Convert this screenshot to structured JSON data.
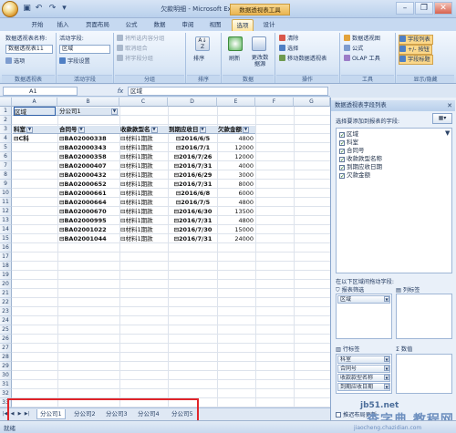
{
  "window": {
    "title": "欠款明细 - Microsoft Excel",
    "context_tab_group": "数据透视表工具"
  },
  "tabs": [
    "开始",
    "插入",
    "页面布局",
    "公式",
    "数据",
    "审阅",
    "视图",
    "选项",
    "设计"
  ],
  "active_tab": "选项",
  "ribbon": {
    "pivot_name_label": "数据透视表名称:",
    "pivot_name_value": "数据透视表11",
    "options_label": "选项",
    "group_pivot": "数据透视表",
    "active_field_label": "活动字段:",
    "active_field_value": "区域",
    "field_settings": "字段设置",
    "group_active_field": "活动字段",
    "ungroup_selection": "将所选内容分组",
    "cancel_group": "取消组合",
    "group_field": "将字段分组",
    "group_grouping": "分组",
    "sort": "排序",
    "group_sort": "排序",
    "refresh": "刷新",
    "change_source": "更改数据源",
    "group_data": "数据",
    "clear": "清除",
    "select": "选择",
    "move_pivot": "移动数据透视表",
    "group_actions": "操作",
    "pivot_chart": "数据透视图",
    "formulas": "公式",
    "olap_tools": "OLAP 工具",
    "group_tools": "工具",
    "field_list": "字段列表",
    "buttons": "+/- 按钮",
    "field_headers": "字段标题",
    "group_show": "显示/隐藏"
  },
  "formula_bar": {
    "name_box": "A1",
    "fx": "fx",
    "content": "区域"
  },
  "columns": [
    "A",
    "B",
    "C",
    "D",
    "E",
    "F",
    "G"
  ],
  "rows": [
    "1",
    "2",
    "3",
    "4",
    "5",
    "6",
    "7",
    "8",
    "9",
    "10",
    "11",
    "12",
    "13",
    "14",
    "15",
    "16",
    "17",
    "18",
    "19",
    "20",
    "21",
    "22",
    "23",
    "24",
    "25",
    "26",
    "27",
    "28",
    "29",
    "30",
    "31",
    "32",
    "33"
  ],
  "pivot": {
    "filter_field": "区域",
    "filter_value": "分公司1",
    "headers": [
      "科室",
      "合同号",
      "收款款型名",
      "到期应收日",
      "欠款金额"
    ],
    "dept": "C科",
    "records": [
      {
        "contract": "BA02000338",
        "type": "材料1期款",
        "date": "2016/6/5",
        "amount": "4800"
      },
      {
        "contract": "BA02000343",
        "type": "材料1期款",
        "date": "2016/7/1",
        "amount": "12000"
      },
      {
        "contract": "BA02000358",
        "type": "材料1期款",
        "date": "2016/7/26",
        "amount": "12000"
      },
      {
        "contract": "BA02000407",
        "type": "材料1期款",
        "date": "2016/7/31",
        "amount": "4000"
      },
      {
        "contract": "BA02000432",
        "type": "材料1期款",
        "date": "2016/6/29",
        "amount": "3000"
      },
      {
        "contract": "BA02000652",
        "type": "材料1期款",
        "date": "2016/7/31",
        "amount": "8000"
      },
      {
        "contract": "BA02000661",
        "type": "材料1期款",
        "date": "2016/6/8",
        "amount": "6000"
      },
      {
        "contract": "BA02000664",
        "type": "材料1期款",
        "date": "2016/7/5",
        "amount": "4800"
      },
      {
        "contract": "BA02000670",
        "type": "材料1期款",
        "date": "2016/6/30",
        "amount": "13500"
      },
      {
        "contract": "BA02000995",
        "type": "材料1期款",
        "date": "2016/7/31",
        "amount": "4800"
      },
      {
        "contract": "BA02001022",
        "type": "材料1期款",
        "date": "2016/7/30",
        "amount": "15000"
      },
      {
        "contract": "BA02001044",
        "type": "材料1期款",
        "date": "2016/7/31",
        "amount": "24000"
      }
    ]
  },
  "sheet_tabs": [
    "分公司1",
    "分公司2",
    "分公司3",
    "分公司4",
    "分公司5"
  ],
  "status_bar": {
    "text": "就绪"
  },
  "field_pane": {
    "title": "数据透视表字段列表",
    "prompt": "选择要添加到报表的字段:",
    "fields": [
      {
        "name": "区域",
        "checked": true
      },
      {
        "name": "科室",
        "checked": true
      },
      {
        "name": "合同号",
        "checked": true
      },
      {
        "name": "收款款型名称",
        "checked": true
      },
      {
        "name": "到期应收日期",
        "checked": true
      },
      {
        "name": "欠款金额",
        "checked": true
      }
    ],
    "drag_prompt": "在以下区域间拖动字段:",
    "report_filter_label": "报表筛选",
    "column_label": "列标签",
    "row_label": "行标签",
    "values_label": "数值",
    "filter_chips": [
      "区域"
    ],
    "row_chips": [
      "科室",
      "合同号",
      "收款款型名称",
      "到期应收日期"
    ],
    "defer_update": "推迟布局更新"
  },
  "watermark": {
    "line1": "jb51.net",
    "line2": "查字典 教程网",
    "line3": "jiaocheng.chazidian.com"
  },
  "colors": {
    "highlight_border": "#e0242a",
    "ribbon_active": "#fde39d"
  }
}
